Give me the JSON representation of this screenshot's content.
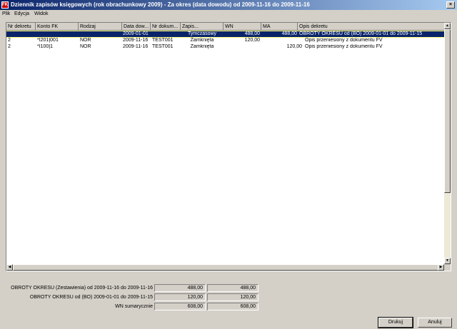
{
  "window": {
    "icon_label": "FK",
    "title": "Dziennik zapisów księgowych (rok obrachunkowy 2009) - Za okres (data dowodu) od 2009-11-16 do 2009-11-16",
    "close_glyph": "×"
  },
  "menu": [
    "Plik",
    "Edycja",
    "Widok"
  ],
  "columns": [
    "Nr dekretu",
    "Konto FK",
    "Rodzaj",
    "Data dow...",
    "Nr dokum...",
    "Zapis...",
    "WN",
    "MA",
    "Opis dekretu"
  ],
  "rows": [
    {
      "nr": "",
      "konto": "",
      "rodzaj": "",
      "data": "2009-01-01",
      "nrdok": "",
      "zapis": "Tymczasowy",
      "wn": "488,00",
      "ma": "488,00",
      "opis": "OBROTY OKRESU od (BO) 2009-01-01 do 2009-11-15"
    },
    {
      "nr": "2",
      "konto": "*I201|001",
      "rodzaj": "NOR",
      "data": "2009-11-16",
      "nrdok": "TEST001",
      "zapis": "Zamknięta",
      "wn": "120,00",
      "ma": "",
      "opis": "Opis przeniesiony z dokumentu FV"
    },
    {
      "nr": "2",
      "konto": "*I100|1",
      "rodzaj": "NOR",
      "data": "2009-11-16",
      "nrdok": "TEST001",
      "zapis": "Zamknięta",
      "wn": "",
      "ma": "120,00",
      "opis": "Opis przeniesiony z dokumentu FV"
    }
  ],
  "summary": [
    {
      "label": "OBROTY OKRESU (Zestawienia) od 2009-11-16 do 2009-11-16",
      "wn": "488,00",
      "ma": "488,00"
    },
    {
      "label": "OBROTY OKRESU od (BO) 2009-01-01 do 2009-11-15",
      "wn": "120,00",
      "ma": "120,00"
    },
    {
      "label": "WN sumarycznie",
      "wn": "608,00",
      "ma": "608,00"
    }
  ],
  "buttons": {
    "print": "Drukuj",
    "cancel": "Anuluj"
  },
  "scroll_glyphs": {
    "up": "▲",
    "down": "▼",
    "left": "◀",
    "right": "▶"
  }
}
